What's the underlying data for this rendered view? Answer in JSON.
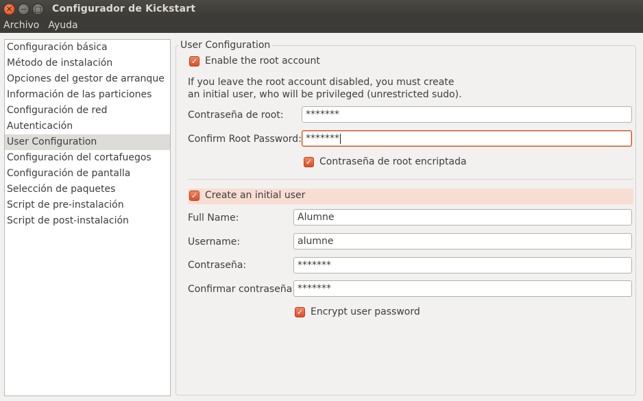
{
  "window": {
    "title": "Configurador de Kickstart",
    "controls": [
      "close-icon",
      "minimize-icon",
      "maximize-icon"
    ]
  },
  "menubar": [
    "Archivo",
    "Ayuda"
  ],
  "sidebar": {
    "items": [
      "Configuración básica",
      "Método de instalación",
      "Opciones del gestor de arranque",
      "Información de las particiones",
      "Configuración de red",
      "Autenticación",
      "User Configuration",
      "Configuración del cortafuegos",
      "Configuración de pantalla",
      "Selección de paquetes",
      "Script de pre-instalación",
      "Script de post-instalación"
    ],
    "selected": "User Configuration"
  },
  "panel": {
    "frame_title": "User Configuration",
    "enable_root": {
      "label": "Enable the root account",
      "checked": true
    },
    "info_line1": "If you leave the root account disabled, you must create",
    "info_line2": "an initial user, who will be privileged (unrestricted sudo).",
    "root_password": {
      "label": "Contraseña de root:",
      "value": "*******"
    },
    "confirm_root_password": {
      "label": "Confirm Root Password:",
      "value": "*******"
    },
    "root_encrypted": {
      "label": "Contraseña de root encriptada",
      "checked": true
    },
    "create_user": {
      "label": "Create an initial user",
      "checked": true
    },
    "full_name": {
      "label": "Full Name:",
      "value": "Alumne"
    },
    "username": {
      "label": "Username:",
      "value": "alumne"
    },
    "password": {
      "label": "Contraseña:",
      "value": "*******"
    },
    "confirm_password": {
      "label": "Confirmar contraseña:",
      "value": "*******"
    },
    "encrypt_user_password": {
      "label": "Encrypt user password",
      "checked": true
    }
  },
  "colors": {
    "accent": "#dd4814",
    "titlebar": "#3c3b37",
    "highlight_row": "#f8ddd3",
    "selected_item": "#dedcd8"
  }
}
